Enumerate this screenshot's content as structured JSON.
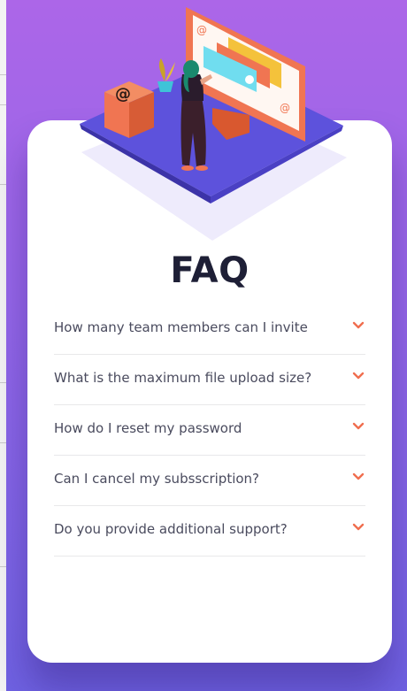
{
  "faq": {
    "title": "FAQ",
    "items": [
      {
        "question": "How many team members can I invite"
      },
      {
        "question": "What is the maximum file upload size?"
      },
      {
        "question": "How do I reset my password"
      },
      {
        "question": "Can I cancel my subsscription?"
      },
      {
        "question": "Do you provide additional support?"
      }
    ]
  },
  "icons": {
    "chevron": "chevron-down-icon"
  },
  "colors": {
    "background_top": "#ac66e8",
    "background_bottom": "#6f62e2",
    "card": "#ffffff",
    "title": "#1e1f36",
    "question_text": "#4a4b5e",
    "chevron": "#f06e4f",
    "divider": "#e8e8ea"
  }
}
